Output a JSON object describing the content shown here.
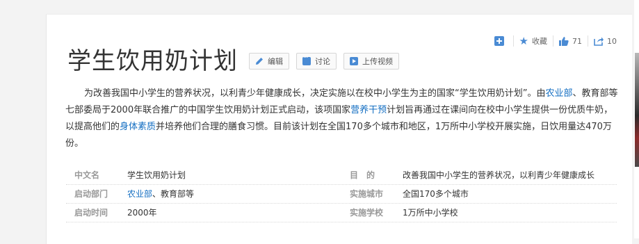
{
  "actions": {
    "add_label": "",
    "favorite_label": "收藏",
    "like_count": "71",
    "share_count": "10"
  },
  "title": "学生饮用奶计划",
  "buttons": {
    "edit": "编辑",
    "discuss": "讨论",
    "upload_video": "上传视频"
  },
  "description": {
    "part1": "为改善我国中小学生的营养状况，以利青少年健康成长，决定实施以在校中小学生为主的国家“学生饮用奶计划”。由",
    "link1": "农业部",
    "part2": "、教育部等七部委局于2000年联合推广的中国学生饮用奶计划正式启动，该项国家",
    "link2": "营养干预",
    "part3": "计划旨再通过在课间向在校中小学生提供一份优质牛奶，以提高他们的",
    "link3": "身体素质",
    "part4": "并培养他们合理的膳食习惯。目前该计划在全国170多个城市和地区，1万所中小学校开展实施，日饮用量达470万份。"
  },
  "info": [
    {
      "k1": "中文名",
      "v1": "学生饮用奶计划",
      "v1_link": "",
      "v1_rest": "",
      "k2": "目　的",
      "v2": "改善我国中小学生的营养状况，以利青少年健康成长"
    },
    {
      "k1": "启动部门",
      "v1": "",
      "v1_link": "农业部",
      "v1_rest": "、教育部等",
      "k2": "实施城市",
      "v2": "全国170多个城市"
    },
    {
      "k1": "启动时间",
      "v1": "2000年",
      "v1_link": "",
      "v1_rest": "",
      "k2": "实施学校",
      "v2": "1万所中小学校"
    }
  ],
  "colors": {
    "accent": "#4a8bd4",
    "link": "#136ec2"
  }
}
